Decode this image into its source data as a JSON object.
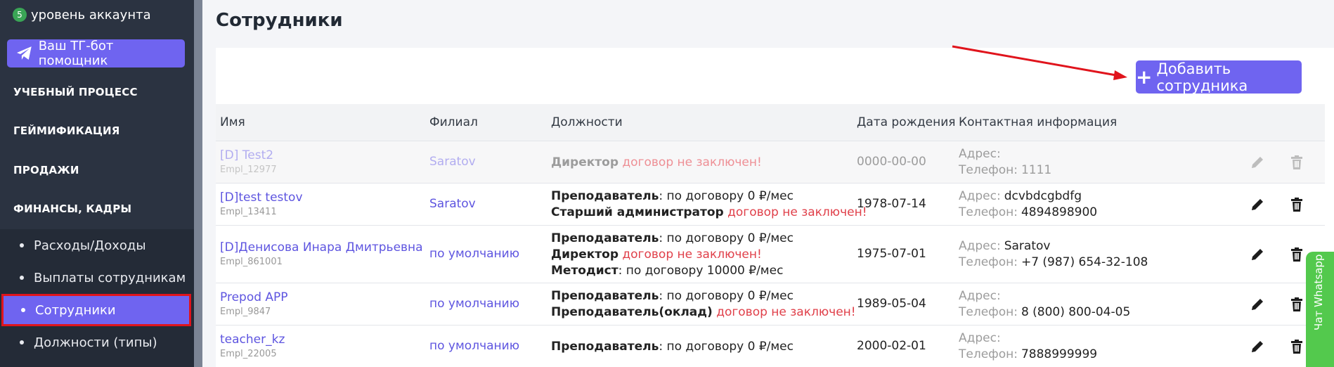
{
  "sidebar": {
    "account_level_badge": "5",
    "account_level_label": "уровень аккаунта",
    "tg_button_label": "Ваш ТГ-бот помощник",
    "sections": [
      "УЧЕБНЫЙ ПРОЦЕСС",
      "ГЕЙМИФИКАЦИЯ",
      "ПРОДАЖИ",
      "ФИНАНСЫ, КАДРЫ"
    ],
    "sub_items": [
      "Расходы/Доходы",
      "Выплаты сотрудникам",
      "Сотрудники",
      "Должности (типы)"
    ],
    "active_sub_item": "Сотрудники"
  },
  "page": {
    "title": "Сотрудники",
    "add_button_label": "Добавить сотрудника"
  },
  "table": {
    "headers": [
      "Имя",
      "Филиал",
      "Должности",
      "Дата рождения",
      "Контактная информация"
    ],
    "rows": [
      {
        "name": "[D] Test2",
        "empl_id": "Empl_12977",
        "branch": "Saratov",
        "positions": [
          {
            "title": "Директор",
            "sep": " ",
            "detail": "договор не заключен!",
            "detail_red": true
          }
        ],
        "birth_date": "0000-00-00",
        "address_label": "Адрес:",
        "address": "",
        "phone_label": "Телефон:",
        "phone": "1111",
        "faded": true
      },
      {
        "name": "[D]test testov",
        "empl_id": "Empl_13411",
        "branch": "Saratov",
        "positions": [
          {
            "title": "Преподаватель",
            "sep": ": ",
            "detail": "по договору 0 ₽/мес",
            "detail_red": false
          },
          {
            "title": "Старший администратор",
            "sep": " ",
            "detail": "договор не заключен!",
            "detail_red": true
          }
        ],
        "birth_date": "1978-07-14",
        "address_label": "Адрес:",
        "address": "dcvbdcgbdfg",
        "phone_label": "Телефон:",
        "phone": "4894898900",
        "faded": false
      },
      {
        "name": "[D]Денисова Инара Дмитрьевна",
        "empl_id": "Empl_861001",
        "branch": "по умолчанию",
        "positions": [
          {
            "title": "Преподаватель",
            "sep": ": ",
            "detail": "по договору 0 ₽/мес",
            "detail_red": false
          },
          {
            "title": "Директор",
            "sep": " ",
            "detail": "договор не заключен!",
            "detail_red": true
          },
          {
            "title": "Методист",
            "sep": ": ",
            "detail": "по договору 10000 ₽/мес",
            "detail_red": false
          }
        ],
        "birth_date": "1975-07-01",
        "address_label": "Адрес:",
        "address": "Saratov",
        "phone_label": "Телефон:",
        "phone": "+7 (987) 654-32-108",
        "faded": false
      },
      {
        "name": "Prepod APP",
        "empl_id": "Empl_9847",
        "branch": "по умолчанию",
        "positions": [
          {
            "title": "Преподаватель",
            "sep": ": ",
            "detail": "по договору 0 ₽/мес",
            "detail_red": false
          },
          {
            "title": "Преподаватель(оклад)",
            "sep": " ",
            "detail": "договор не заключен!",
            "detail_red": true
          }
        ],
        "birth_date": "1989-05-04",
        "address_label": "Адрес:",
        "address": "",
        "phone_label": "Телефон:",
        "phone": "8 (800) 800-04-05",
        "faded": false
      },
      {
        "name": "teacher_kz",
        "empl_id": "Empl_22005",
        "branch": "по умолчанию",
        "positions": [
          {
            "title": "Преподаватель",
            "sep": ": ",
            "detail": "по договору 0 ₽/мес",
            "detail_red": false
          }
        ],
        "birth_date": "2000-02-01",
        "address_label": "Адрес:",
        "address": "",
        "phone_label": "Телефон:",
        "phone": "7888999999",
        "faded": false
      }
    ]
  },
  "whatsapp": {
    "label": "Чат Whatsapp"
  },
  "colors": {
    "accent": "#6f64f0",
    "sidebar": "#2b3341",
    "danger": "#e0404a",
    "whatsapp": "#53c94d"
  }
}
